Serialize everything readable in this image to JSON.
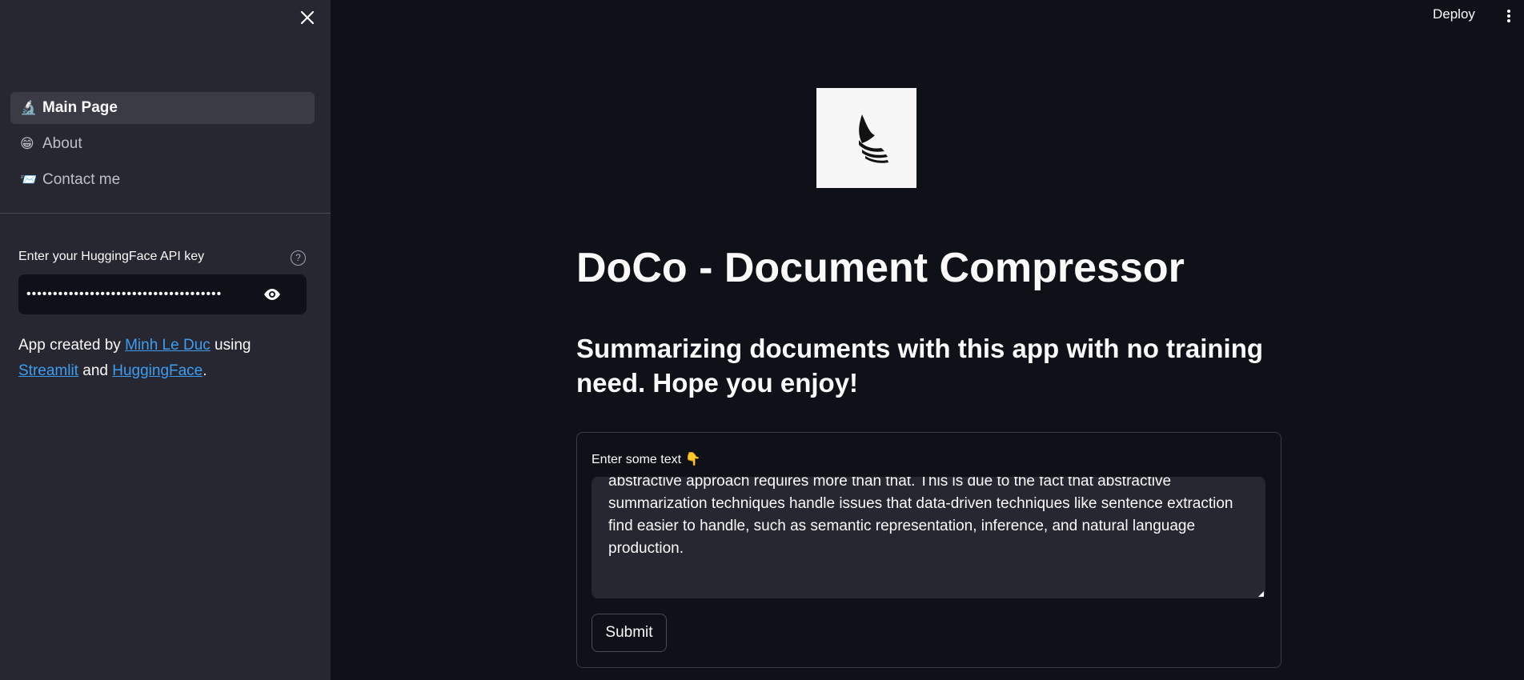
{
  "sidebar": {
    "nav": [
      {
        "emoji": "🔬",
        "label": "Main Page",
        "active": true
      },
      {
        "emoji": "😁",
        "label": "About",
        "active": false
      },
      {
        "emoji": "📨",
        "label": "Contact me",
        "active": false
      }
    ],
    "api_key_label": "Enter your HuggingFace API key",
    "api_key_value": "•••••••••••••••••••••••••••••••••••••",
    "help_icon_glyph": "?",
    "credit": {
      "prefix": "App created by",
      "author": "Minh Le Duc",
      "using": "using",
      "streamlit": "Streamlit",
      "and": "and",
      "huggingface": "HuggingFace",
      "suffix": "."
    }
  },
  "header": {
    "deploy_label": "Deploy"
  },
  "main": {
    "title": "DoCo - Document Compressor",
    "subtitle": "Summarizing documents with this app with no training need. Hope you enjoy!",
    "form": {
      "label": "Enter some text 👇",
      "text": "abstractive approach requires more than that. This is due to the fact that abstractive summarization techniques handle issues that data-driven techniques like sentence extraction find easier to handle, such as semantic representation, inference, and natural language production.",
      "submit_label": "Submit"
    }
  },
  "colors": {
    "background": "#0e1117",
    "sidebar": "#262730",
    "link": "#3d9df3",
    "text": "#fafafa"
  }
}
